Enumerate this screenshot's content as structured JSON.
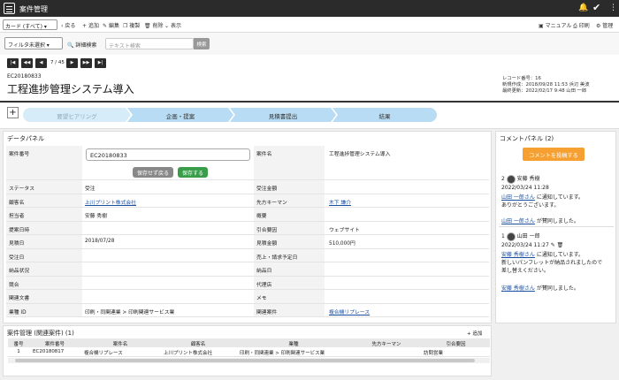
{
  "app": {
    "title": "案件管理"
  },
  "toolbar": {
    "view_select": "カード (すべて)",
    "back": "戻る",
    "add": "追加",
    "edit": "編集",
    "copy": "複製",
    "delete": "削除",
    "display": "表示",
    "manual": "マニュアル",
    "print": "印刷",
    "admin": "管理"
  },
  "filter": {
    "select": "フィルタ未選択",
    "detail_search": "詳細検索",
    "placeholder": "テキスト検索",
    "search_btn": "検索"
  },
  "pager": {
    "text": "7 / 45"
  },
  "record": {
    "code": "EC20180833",
    "title": "工程進捗管理システム導入",
    "record_no": "レコード番号：16",
    "created": "新規作成：2018/09/28 11:53 浜辺 美波",
    "updated": "最終更新：2022/02/17 9:48 山田 一郎"
  },
  "steps": [
    "要望ヒアリング",
    "企画・提案",
    "見積書提出",
    "結果"
  ],
  "data_panel": {
    "title": "データパネル",
    "case_no_label": "案件番号",
    "case_no_value": "EC20180833",
    "btn_back": "保存せず戻る",
    "btn_save": "保存する",
    "case_name_label": "案件名",
    "case_name_value": "工程進捗管理システム導入",
    "rows": [
      {
        "l1": "ステータス",
        "v1": "受注",
        "l2": "受注金額",
        "v2": ""
      },
      {
        "l1": "顧客名",
        "v1": "上川プリント株式会社",
        "l2": "先方キーマン",
        "v2": "木下 謙介"
      },
      {
        "l1": "担当者",
        "v1": "安藤 秀樹",
        "l2": "概要",
        "v2": ""
      },
      {
        "l1": "提案日時",
        "v1": "",
        "l2": "引合要因",
        "v2": "ウェブサイト"
      },
      {
        "l1": "見積日",
        "v1": "2018/07/28",
        "l2": "見積金額",
        "v2": "510,000円"
      },
      {
        "l1": "受注日",
        "v1": "",
        "l2": "売上・請求予定日",
        "v2": ""
      },
      {
        "l1": "納品状況",
        "v1": "",
        "l2": "納品日",
        "v2": ""
      },
      {
        "l1": "競合",
        "v1": "",
        "l2": "代理店",
        "v2": ""
      },
      {
        "l1": "関連文書",
        "v1": "",
        "l2": "メモ",
        "v2": ""
      },
      {
        "l1": "業種 ID",
        "v1": "印刷・同関連業 > 印刷関連サービス業",
        "l2": "関連案件",
        "v2": "複合機リプレース"
      }
    ]
  },
  "comments": {
    "title": "コメントパネル (2)",
    "post_btn": "コメントを投稿する",
    "items": [
      {
        "no": "2",
        "user": "安藤 秀樹",
        "date": "2022/03/24 11:28",
        "line1": "山田 一郎さん",
        "line1b": " に通知しています。",
        "line2": "ありがとうございます。",
        "like": "山田 一郎さん",
        "likeb": " が賛同しました。"
      },
      {
        "no": "1",
        "user": "山田 一郎",
        "date": "2022/03/24 11:27",
        "line1": "安藤 秀樹さん",
        "line1b": " に通知しています。",
        "line2": "新しいパンフレットが納品されましたので",
        "line3": "差し替えください。",
        "like": "安藤 秀樹さん",
        "likeb": " が賛同しました。"
      }
    ]
  },
  "related": {
    "title": "案件管理 (関連案件) (1)",
    "add": "追加",
    "headers": [
      "番号",
      "案件番号",
      "案件名",
      "顧客名",
      "業種",
      "先方キーマン",
      "引合要因"
    ],
    "row": [
      "1",
      "EC20180817",
      "複合機リプレース",
      "上川プリント株式会社",
      "印刷・同関連業 > 印刷関連サービス業",
      "",
      "訪問営業"
    ]
  }
}
